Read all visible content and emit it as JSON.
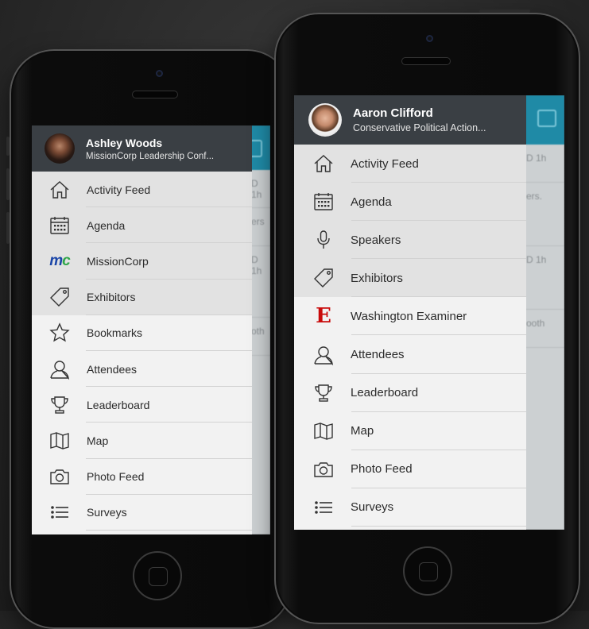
{
  "colors": {
    "drawer_bg": "#f2f2f2",
    "header_bg": "#3a3f44",
    "accent": "#1f8aa6",
    "missioncorp_blue": "#1b46a8",
    "missioncorp_green": "#30a64a",
    "examiner_red": "#c90a0a"
  },
  "left_phone": {
    "user": {
      "name": "Ashley Woods",
      "subtitle": "MissionCorp Leadership Conf...",
      "avatar_icon": "user-photo"
    },
    "menu": [
      {
        "label": "Activity Feed",
        "icon": "home-icon"
      },
      {
        "label": "Agenda",
        "icon": "calendar-icon"
      },
      {
        "label": "MissionCorp",
        "icon": "missioncorp-logo",
        "logo_m": "m",
        "logo_c": "c"
      },
      {
        "label": "Exhibitors",
        "icon": "tag-icon"
      },
      {
        "label": "Bookmarks",
        "icon": "star-icon"
      },
      {
        "label": "Attendees",
        "icon": "person-icon"
      },
      {
        "label": "Leaderboard",
        "icon": "trophy-icon"
      },
      {
        "label": "Map",
        "icon": "map-icon"
      },
      {
        "label": "Photo Feed",
        "icon": "camera-icon"
      },
      {
        "label": "Surveys",
        "icon": "list-icon"
      }
    ],
    "background_snippets": [
      "D 1h",
      "ers",
      "D 1h",
      "oth"
    ]
  },
  "right_phone": {
    "user": {
      "name": "Aaron Clifford",
      "subtitle": "Conservative Political Action...",
      "avatar_icon": "user-photo"
    },
    "menu": [
      {
        "label": "Activity Feed",
        "icon": "home-icon"
      },
      {
        "label": "Agenda",
        "icon": "calendar-icon"
      },
      {
        "label": "Speakers",
        "icon": "microphone-icon"
      },
      {
        "label": "Exhibitors",
        "icon": "tag-icon"
      },
      {
        "label": "Washington Examiner",
        "icon": "washington-examiner-logo",
        "logo_text": "E"
      },
      {
        "label": "Attendees",
        "icon": "person-icon"
      },
      {
        "label": "Leaderboard",
        "icon": "trophy-icon"
      },
      {
        "label": "Map",
        "icon": "map-icon"
      },
      {
        "label": "Photo Feed",
        "icon": "camera-icon"
      },
      {
        "label": "Surveys",
        "icon": "list-icon"
      }
    ],
    "background_snippets": [
      "D 1h",
      "ers.",
      "D 1h",
      "ooth"
    ]
  }
}
